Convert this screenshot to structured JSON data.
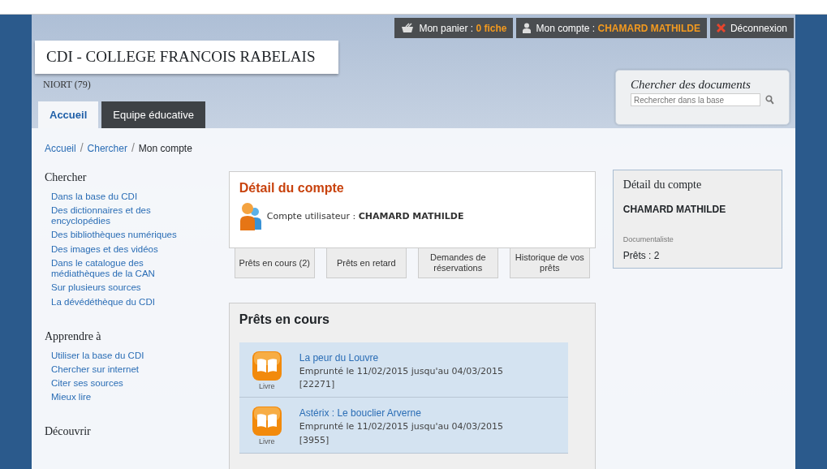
{
  "top_bar": [
    {
      "kind": "basket",
      "label": "Mon panier : ",
      "value": "0 fiche"
    },
    {
      "kind": "account",
      "label": "Mon compte : ",
      "value": "CHAMARD MATHILDE"
    },
    {
      "kind": "logout",
      "label": "Déconnexion"
    }
  ],
  "site": {
    "title": "CDI - COLLEGE FRANCOIS RABELAIS",
    "subtitle": "NIORT (79)"
  },
  "tabs": [
    {
      "label": "Accueil",
      "selected": true
    },
    {
      "label": "Equipe éducative",
      "selected": false
    }
  ],
  "search": {
    "title": "Chercher des documents",
    "placeholder": "Rechercher dans la base"
  },
  "breadcrumb": {
    "links": [
      "Accueil",
      "Chercher"
    ],
    "separator": "/",
    "current": "Mon compte"
  },
  "sidebar": [
    {
      "title": "Chercher",
      "items": [
        "Dans la base du CDI",
        "Des dictionnaires et des encyclopédies",
        "Des bibliothèques numériques",
        "Des images et des vidéos",
        "Dans le catalogue des médiathèques de la CAN",
        "Sur plusieurs sources",
        "La dévédéthèque du CDI"
      ]
    },
    {
      "title": "Apprendre à",
      "items": [
        "Utiliser la base du CDI",
        "Chercher sur internet",
        "Citer ses sources",
        "Mieux lire"
      ]
    },
    {
      "title": "Découvrir"
    }
  ],
  "account": {
    "title": "Détail du compte",
    "label": "Compte utilisateur : ",
    "name": "CHAMARD MATHILDE"
  },
  "loan_tabs": [
    "Prêts en cours (2)",
    "Prêts en retard",
    "Demandes de réservations",
    "Historique de vos prêts"
  ],
  "loans": {
    "title": "Prêts en cours",
    "items": [
      {
        "type": "Livre",
        "title": "La peur du Louvre",
        "dates": "Emprunté le 11/02/2015 jusqu'au 04/03/2015",
        "ref": "[22271]"
      },
      {
        "type": "Livre",
        "title": "Astérix : Le bouclier Arverne",
        "dates": "Emprunté le 11/02/2015 jusqu'au 04/03/2015",
        "ref": "[3955]"
      }
    ]
  },
  "summary": {
    "title": "Détail du compte",
    "name": "CHAMARD MATHILDE",
    "role": "Documentaliste",
    "loans": "Prêts : 2"
  }
}
